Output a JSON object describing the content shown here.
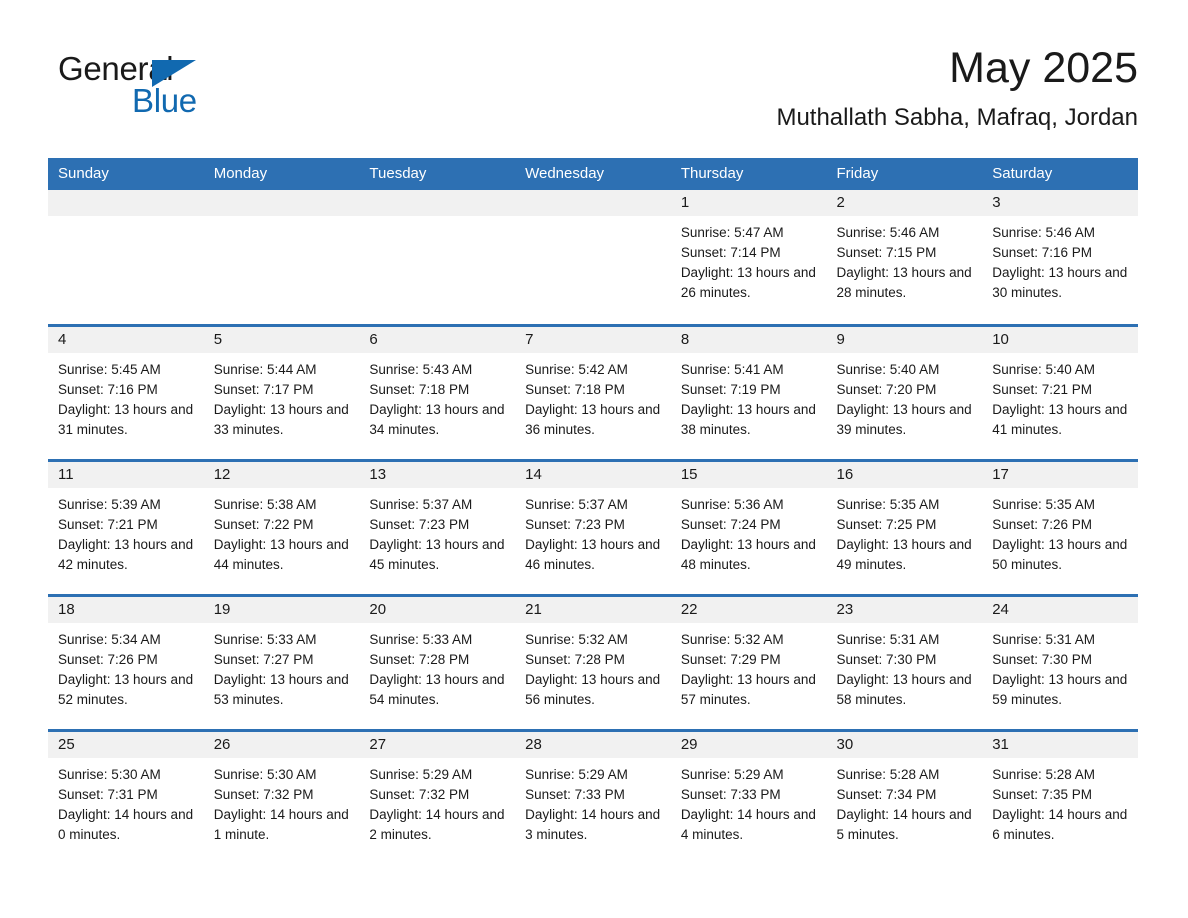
{
  "brand": {
    "name_part1": "General",
    "name_part2": "Blue",
    "logo_triangle": "triangle-icon",
    "accent_color": "#1169b0"
  },
  "header": {
    "title": "May 2025",
    "location": "Muthallath Sabha, Mafraq, Jordan"
  },
  "theme": {
    "header_blue": "#2d70b3",
    "date_strip_gray": "#f1f1f1",
    "text_black": "#1a1a1a"
  },
  "calendar": {
    "weekday_headers": [
      "Sunday",
      "Monday",
      "Tuesday",
      "Wednesday",
      "Thursday",
      "Friday",
      "Saturday"
    ],
    "weeks": [
      [
        {
          "date": "",
          "lines": []
        },
        {
          "date": "",
          "lines": []
        },
        {
          "date": "",
          "lines": []
        },
        {
          "date": "",
          "lines": []
        },
        {
          "date": "1",
          "lines": [
            "Sunrise: 5:47 AM",
            "Sunset: 7:14 PM",
            "Daylight: 13 hours and 26 minutes."
          ]
        },
        {
          "date": "2",
          "lines": [
            "Sunrise: 5:46 AM",
            "Sunset: 7:15 PM",
            "Daylight: 13 hours and 28 minutes."
          ]
        },
        {
          "date": "3",
          "lines": [
            "Sunrise: 5:46 AM",
            "Sunset: 7:16 PM",
            "Daylight: 13 hours and 30 minutes."
          ]
        }
      ],
      [
        {
          "date": "4",
          "lines": [
            "Sunrise: 5:45 AM",
            "Sunset: 7:16 PM",
            "Daylight: 13 hours and 31 minutes."
          ]
        },
        {
          "date": "5",
          "lines": [
            "Sunrise: 5:44 AM",
            "Sunset: 7:17 PM",
            "Daylight: 13 hours and 33 minutes."
          ]
        },
        {
          "date": "6",
          "lines": [
            "Sunrise: 5:43 AM",
            "Sunset: 7:18 PM",
            "Daylight: 13 hours and 34 minutes."
          ]
        },
        {
          "date": "7",
          "lines": [
            "Sunrise: 5:42 AM",
            "Sunset: 7:18 PM",
            "Daylight: 13 hours and 36 minutes."
          ]
        },
        {
          "date": "8",
          "lines": [
            "Sunrise: 5:41 AM",
            "Sunset: 7:19 PM",
            "Daylight: 13 hours and 38 minutes."
          ]
        },
        {
          "date": "9",
          "lines": [
            "Sunrise: 5:40 AM",
            "Sunset: 7:20 PM",
            "Daylight: 13 hours and 39 minutes."
          ]
        },
        {
          "date": "10",
          "lines": [
            "Sunrise: 5:40 AM",
            "Sunset: 7:21 PM",
            "Daylight: 13 hours and 41 minutes."
          ]
        }
      ],
      [
        {
          "date": "11",
          "lines": [
            "Sunrise: 5:39 AM",
            "Sunset: 7:21 PM",
            "Daylight: 13 hours and 42 minutes."
          ]
        },
        {
          "date": "12",
          "lines": [
            "Sunrise: 5:38 AM",
            "Sunset: 7:22 PM",
            "Daylight: 13 hours and 44 minutes."
          ]
        },
        {
          "date": "13",
          "lines": [
            "Sunrise: 5:37 AM",
            "Sunset: 7:23 PM",
            "Daylight: 13 hours and 45 minutes."
          ]
        },
        {
          "date": "14",
          "lines": [
            "Sunrise: 5:37 AM",
            "Sunset: 7:23 PM",
            "Daylight: 13 hours and 46 minutes."
          ]
        },
        {
          "date": "15",
          "lines": [
            "Sunrise: 5:36 AM",
            "Sunset: 7:24 PM",
            "Daylight: 13 hours and 48 minutes."
          ]
        },
        {
          "date": "16",
          "lines": [
            "Sunrise: 5:35 AM",
            "Sunset: 7:25 PM",
            "Daylight: 13 hours and 49 minutes."
          ]
        },
        {
          "date": "17",
          "lines": [
            "Sunrise: 5:35 AM",
            "Sunset: 7:26 PM",
            "Daylight: 13 hours and 50 minutes."
          ]
        }
      ],
      [
        {
          "date": "18",
          "lines": [
            "Sunrise: 5:34 AM",
            "Sunset: 7:26 PM",
            "Daylight: 13 hours and 52 minutes."
          ]
        },
        {
          "date": "19",
          "lines": [
            "Sunrise: 5:33 AM",
            "Sunset: 7:27 PM",
            "Daylight: 13 hours and 53 minutes."
          ]
        },
        {
          "date": "20",
          "lines": [
            "Sunrise: 5:33 AM",
            "Sunset: 7:28 PM",
            "Daylight: 13 hours and 54 minutes."
          ]
        },
        {
          "date": "21",
          "lines": [
            "Sunrise: 5:32 AM",
            "Sunset: 7:28 PM",
            "Daylight: 13 hours and 56 minutes."
          ]
        },
        {
          "date": "22",
          "lines": [
            "Sunrise: 5:32 AM",
            "Sunset: 7:29 PM",
            "Daylight: 13 hours and 57 minutes."
          ]
        },
        {
          "date": "23",
          "lines": [
            "Sunrise: 5:31 AM",
            "Sunset: 7:30 PM",
            "Daylight: 13 hours and 58 minutes."
          ]
        },
        {
          "date": "24",
          "lines": [
            "Sunrise: 5:31 AM",
            "Sunset: 7:30 PM",
            "Daylight: 13 hours and 59 minutes."
          ]
        }
      ],
      [
        {
          "date": "25",
          "lines": [
            "Sunrise: 5:30 AM",
            "Sunset: 7:31 PM",
            "Daylight: 14 hours and 0 minutes."
          ]
        },
        {
          "date": "26",
          "lines": [
            "Sunrise: 5:30 AM",
            "Sunset: 7:32 PM",
            "Daylight: 14 hours and 1 minute."
          ]
        },
        {
          "date": "27",
          "lines": [
            "Sunrise: 5:29 AM",
            "Sunset: 7:32 PM",
            "Daylight: 14 hours and 2 minutes."
          ]
        },
        {
          "date": "28",
          "lines": [
            "Sunrise: 5:29 AM",
            "Sunset: 7:33 PM",
            "Daylight: 14 hours and 3 minutes."
          ]
        },
        {
          "date": "29",
          "lines": [
            "Sunrise: 5:29 AM",
            "Sunset: 7:33 PM",
            "Daylight: 14 hours and 4 minutes."
          ]
        },
        {
          "date": "30",
          "lines": [
            "Sunrise: 5:28 AM",
            "Sunset: 7:34 PM",
            "Daylight: 14 hours and 5 minutes."
          ]
        },
        {
          "date": "31",
          "lines": [
            "Sunrise: 5:28 AM",
            "Sunset: 7:35 PM",
            "Daylight: 14 hours and 6 minutes."
          ]
        }
      ]
    ]
  }
}
